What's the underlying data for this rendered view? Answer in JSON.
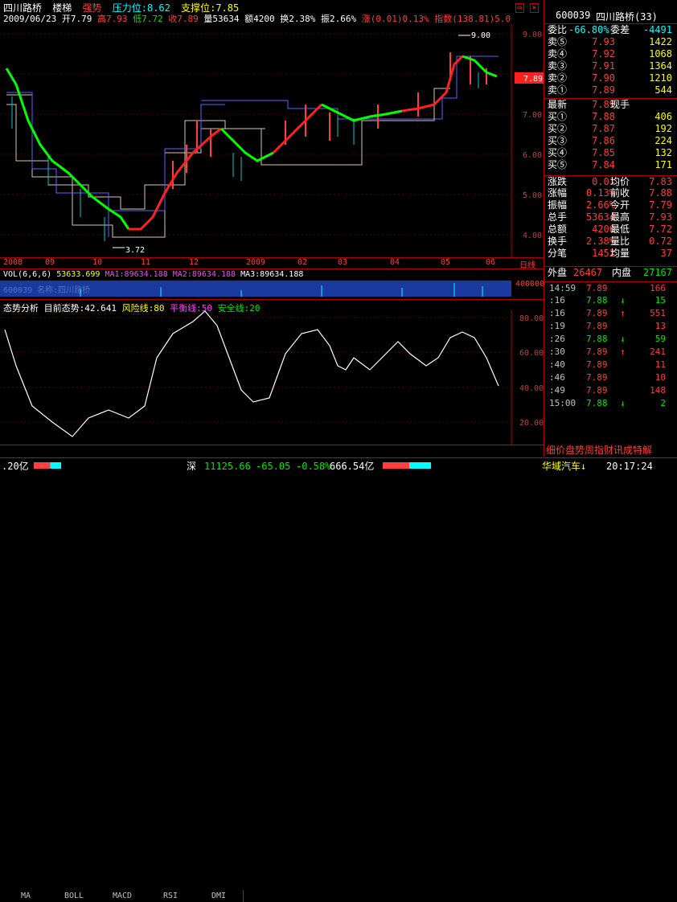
{
  "header": {
    "stock_name": "四川路桥",
    "extra": "楼梯",
    "trend_label": "强势",
    "pressure_label": "压力位:8.62",
    "support_label": "支撑位:7.85"
  },
  "ohlc_line": {
    "date": "2009/06/23",
    "open": "开7.79",
    "high": "高7.93",
    "low": "低7.72",
    "close": "收7.89",
    "volume": "量53634",
    "amount": "额4200",
    "turnover": "换2.38%",
    "amplitude": "振2.66%",
    "change": "涨(0.01)0.13%",
    "index": "指数(138.81)5.0"
  },
  "price_axis": [
    "9.00",
    "8.00",
    "7.00",
    "6.00",
    "5.00",
    "4.00"
  ],
  "current_price_tag": "7.89",
  "high_marker": "9.00",
  "low_marker": "3.72",
  "time_axis": [
    "2008",
    "09",
    "10",
    "11",
    "12",
    "2009",
    "02",
    "03",
    "04",
    "05",
    "06",
    "日线"
  ],
  "vol_line": {
    "title": "VOL(6,6,6)",
    "v": "53633.699",
    "ma1": "MA1:89634.188",
    "ma2": "MA2:89634.188",
    "ma3": "MA3:89634.188",
    "overlay": "600039 名称:四川路桥",
    "scale": "400000"
  },
  "trend_indicator": {
    "title": "态势分析",
    "current": "目前态势:42.641",
    "risk": "风险线:80",
    "balance": "平衡线:50",
    "safe": "安全线:20",
    "axis": [
      "80.00",
      "60.00",
      "40.00",
      "20.00"
    ]
  },
  "bottom_tabs": [
    "MA",
    "BOLL",
    "MACD",
    "RSI",
    "DMI"
  ],
  "quote": {
    "code": "600039",
    "name": "四川路桥(33)",
    "wei_bi_label": "委比",
    "wei_bi": "-66.80%",
    "wei_cha_label": "委差",
    "wei_cha": "-4491",
    "asks": [
      {
        "label": "卖⑤",
        "price": "7.93",
        "vol": "1422"
      },
      {
        "label": "卖④",
        "price": "7.92",
        "vol": "1068"
      },
      {
        "label": "卖③",
        "price": "7.91",
        "vol": "1364"
      },
      {
        "label": "卖②",
        "price": "7.90",
        "vol": "1210"
      },
      {
        "label": "卖①",
        "price": "7.89",
        "vol": "544"
      }
    ],
    "last_label": "最新",
    "last": "7.89",
    "hand_label": "现手",
    "bids": [
      {
        "label": "买①",
        "price": "7.88",
        "vol": "406"
      },
      {
        "label": "买②",
        "price": "7.87",
        "vol": "192"
      },
      {
        "label": "买③",
        "price": "7.86",
        "vol": "224"
      },
      {
        "label": "买④",
        "price": "7.85",
        "vol": "132"
      },
      {
        "label": "买⑤",
        "price": "7.84",
        "vol": "171"
      }
    ],
    "stats": [
      {
        "l1": "涨跌",
        "v1": "0.01",
        "l2": "均价",
        "v2": "7.83"
      },
      {
        "l1": "涨幅",
        "v1": "0.13%",
        "l2": "前收",
        "v2": "7.88"
      },
      {
        "l1": "振幅",
        "v1": "2.66%",
        "l2": "今开",
        "v2": "7.79"
      },
      {
        "l1": "总手",
        "v1": "53634",
        "l2": "最高",
        "v2": "7.93"
      },
      {
        "l1": "总额",
        "v1": "4200",
        "l2": "最低",
        "v2": "7.72"
      },
      {
        "l1": "换手",
        "v1": "2.38%",
        "l2": "量比",
        "v2": "0.72"
      },
      {
        "l1": "分笔",
        "v1": "1452",
        "l2": "均量",
        "v2": "37"
      }
    ],
    "outer_label": "外盘",
    "outer": "26467",
    "inner_label": "内盘",
    "inner": "27167",
    "ticks": [
      {
        "t": "14:59",
        "p": "7.89",
        "a": "",
        "v": "166"
      },
      {
        "t": ":16",
        "p": "7.88",
        "a": "↓",
        "v": "15"
      },
      {
        "t": ":16",
        "p": "7.89",
        "a": "↑",
        "v": "551"
      },
      {
        "t": ":19",
        "p": "7.89",
        "a": "",
        "v": "13"
      },
      {
        "t": ":26",
        "p": "7.88",
        "a": "↓",
        "v": "59"
      },
      {
        "t": ":30",
        "p": "7.89",
        "a": "↑",
        "v": "241"
      },
      {
        "t": ":40",
        "p": "7.89",
        "a": "",
        "v": "11"
      },
      {
        "t": ":46",
        "p": "7.89",
        "a": "",
        "v": "10"
      },
      {
        "t": ":49",
        "p": "7.89",
        "a": "",
        "v": "148"
      },
      {
        "t": "15:00",
        "p": "7.88",
        "a": "↓",
        "v": "2"
      }
    ],
    "bottom_tabs": "细价盘势周指财讯成特解"
  },
  "status_bar": {
    "left": ".20亿",
    "shen_label": "深",
    "shen_index": "11125.66",
    "shen_change": "-65.05",
    "shen_pct": "-0.58%",
    "shen_amount": "666.54亿",
    "ticker": "华域汽车↓",
    "time": "20:17:24"
  }
}
